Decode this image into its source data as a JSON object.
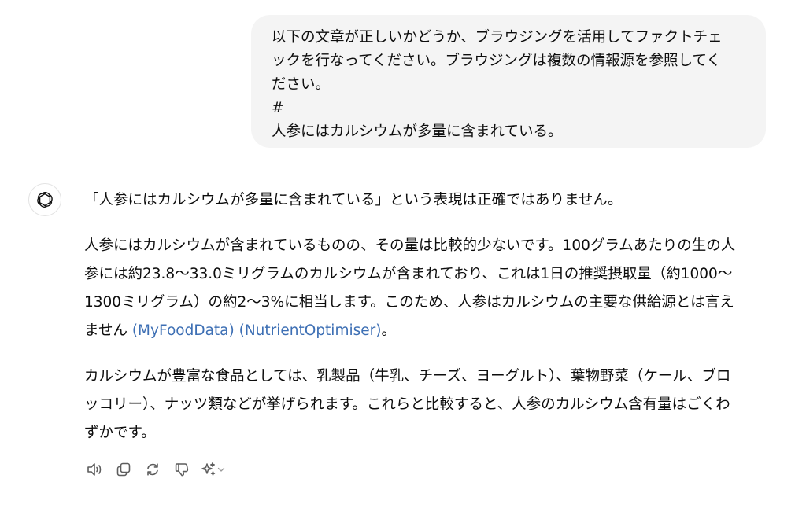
{
  "user_message": {
    "lines": [
      "以下の文章が正しいかどうか、ブラウジングを活用してファクトチェ",
      "ックを行なってください。ブラウジングは複数の情報源を参照してく",
      "ださい。",
      "#",
      "人参にはカルシウムが多量に含まれている。"
    ]
  },
  "assistant_message": {
    "para1": "「人参にはカルシウムが多量に含まれている」という表現は正確ではありません。",
    "para2": {
      "line1": "人参にはカルシウムが含まれているものの、その量は比較的少ないです。100グラムあたりの生の人",
      "line2": "参には約23.8〜33.0ミリグラムのカルシウムが含まれており、これは1日の推奨摂取量（約1000〜",
      "line3": "1300ミリグラム）の約2〜3%に相当します。このため、人参はカルシウムの主要な供給源とは言え",
      "line4_prefix": "ません ",
      "source1": "MyFoodData",
      "source2": "NutrientOptimiser",
      "line4_suffix": "。"
    },
    "para3": {
      "line1": "カルシウムが豊富な食品としては、乳製品（牛乳、チーズ、ヨーグルト）、葉物野菜（ケール、ブロ",
      "line2": "ッコリー）、ナッツ類などが挙げられます。これらと比較すると、人参のカルシウム含有量はごくわ",
      "line3": "ずかです。"
    }
  },
  "actions": {
    "icons": [
      "speaker-icon",
      "copy-icon",
      "regenerate-icon",
      "thumbs-down-icon",
      "sparkle-icon",
      "chevron-down-icon"
    ]
  },
  "colors": {
    "link": "#3d6fb4",
    "bubble_bg": "#f4f4f4",
    "icon": "#5d5d5d",
    "text": "#0d0d0d"
  }
}
